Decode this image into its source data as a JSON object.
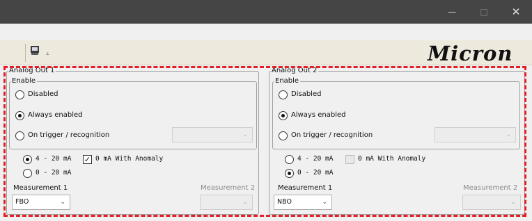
{
  "window": {
    "minimize_glyph": "—",
    "maximize_glyph": "□",
    "close_glyph": "✕"
  },
  "toolbar": {
    "dropdown_glyph": "⩡",
    "brand": "Micron"
  },
  "panels": [
    {
      "title": "Analog Out 1",
      "enable": {
        "title": "Enable",
        "options": [
          "Disabled",
          "Always enabled",
          "On trigger / recognition"
        ],
        "selected": "Always enabled",
        "trigger_select_value": ""
      },
      "ranges": [
        "4 - 20 mA",
        "0 - 20 mA"
      ],
      "selected_range": "4 - 20 mA",
      "anomaly_label": "0 mA With Anomaly",
      "anomaly_checked": true,
      "measurement1_label": "Measurement 1",
      "measurement1_value": "FBO",
      "measurement2_label": "Measurement 2",
      "measurement2_value": ""
    },
    {
      "title": "Analog Out 2",
      "enable": {
        "title": "Enable",
        "options": [
          "Disabled",
          "Always enabled",
          "On trigger / recognition"
        ],
        "selected": "Always enabled",
        "trigger_select_value": ""
      },
      "ranges": [
        "4 - 20 mA",
        "0 - 20 mA"
      ],
      "selected_range": "0 - 20 mA",
      "anomaly_label": "0 mA With Anomaly",
      "anomaly_checked": false,
      "measurement1_label": "Measurement 1",
      "measurement1_value": "NBO",
      "measurement2_label": "Measurement 2",
      "measurement2_value": ""
    }
  ],
  "colors": {
    "titlebar": "#454545",
    "toolbar": "#ede9dd",
    "highlight_dash": "#e31e24"
  }
}
